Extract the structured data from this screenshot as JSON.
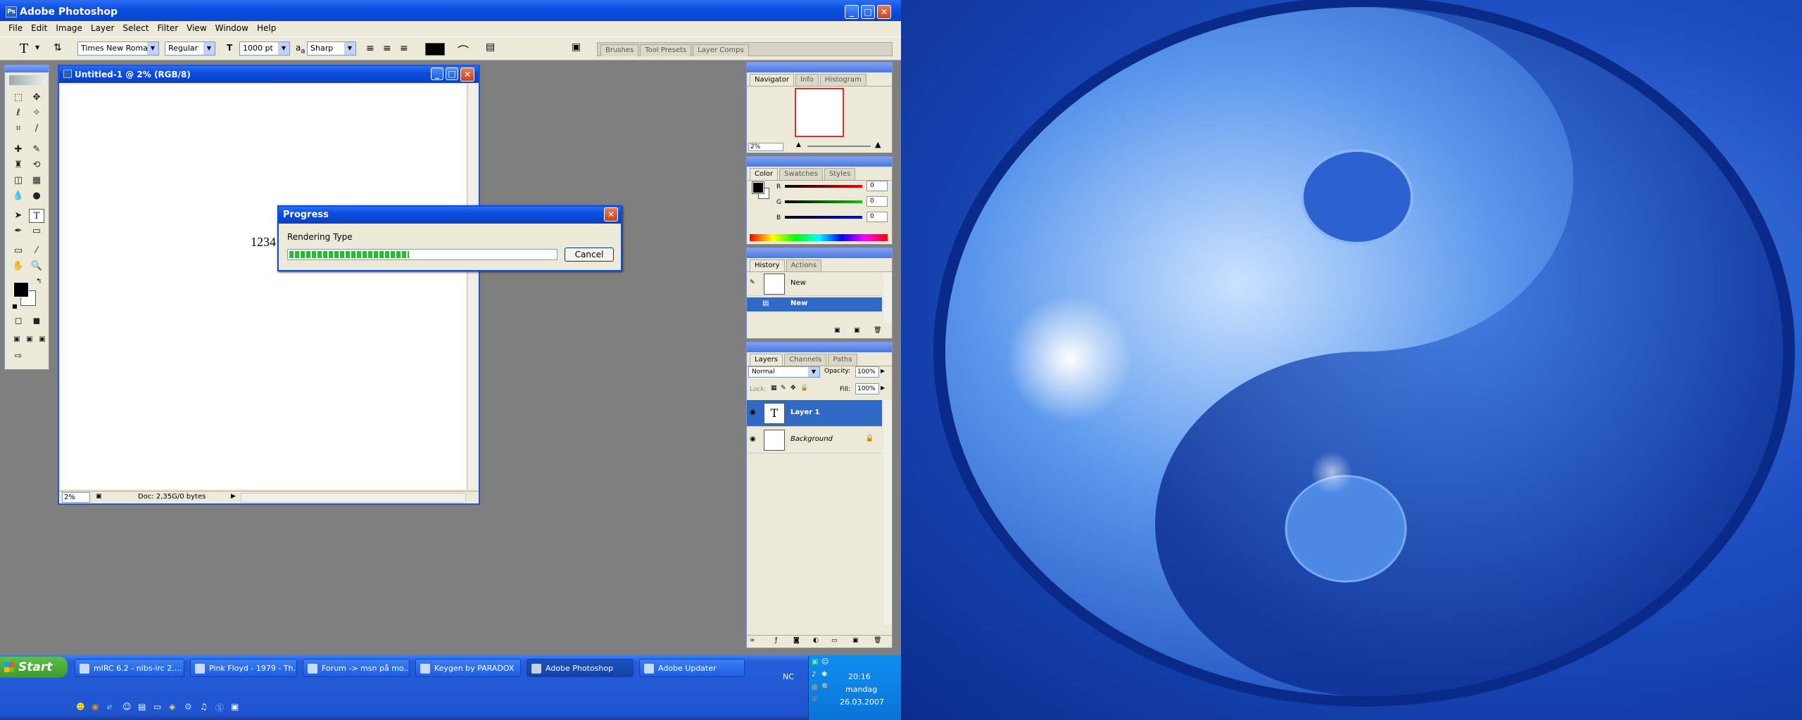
{
  "photoshop": {
    "title": "Adobe Photoshop",
    "menu": [
      "File",
      "Edit",
      "Image",
      "Layer",
      "Select",
      "Filter",
      "View",
      "Window",
      "Help"
    ],
    "options": {
      "font_family": "Times New Roman",
      "font_style": "Regular",
      "font_size": "1000 pt",
      "antialias_prefix": "a",
      "antialias_suffix": "a",
      "antialias": "Sharp",
      "color": "#000000"
    },
    "palette_well": [
      "Brushes",
      "Tool Presets",
      "Layer Comps"
    ]
  },
  "document": {
    "title": "Untitled-1 @ 2% (RGB/8)",
    "canvas_text": "1234",
    "zoom": "2%",
    "doc_info": "Doc: 2,35G/0 bytes"
  },
  "progress": {
    "title": "Progress",
    "message": "Rendering Type",
    "cancel_label": "Cancel",
    "percent": 45
  },
  "navigator": {
    "tabs": [
      "Navigator",
      "Info",
      "Histogram"
    ],
    "zoom": "2%"
  },
  "color_panel": {
    "tabs": [
      "Color",
      "Swatches",
      "Styles"
    ],
    "r_label": "R",
    "g_label": "G",
    "b_label": "B",
    "r": "0",
    "g": "0",
    "b": "0"
  },
  "history": {
    "tabs": [
      "History",
      "Actions"
    ],
    "items": [
      "New",
      "New"
    ]
  },
  "layers": {
    "tabs": [
      "Layers",
      "Channels",
      "Paths"
    ],
    "blend_mode": "Normal",
    "opacity_label": "Opacity:",
    "opacity": "100%",
    "lock_label": "Lock:",
    "fill_label": "Fill:",
    "fill": "100%",
    "items": [
      {
        "name": "Layer 1",
        "thumb": "T"
      },
      {
        "name": "Background",
        "thumb": ""
      }
    ]
  },
  "taskbar": {
    "start": "Start",
    "buttons": [
      "mIRC 6.2 - nibs-irc 2....",
      "Pink Floyd - 1979 - Th...",
      "Forum -> msn på mo...",
      "Keygen by PARADOX",
      "Adobe Photoshop",
      "Adobe Updater"
    ],
    "language": "NC",
    "clock": {
      "time": "20:16",
      "day": "mandag",
      "date": "26.03.2007"
    }
  },
  "colors": {
    "xp_blue": "#245edb",
    "selection": "#316ac5",
    "progress_green": "#22c02e"
  }
}
